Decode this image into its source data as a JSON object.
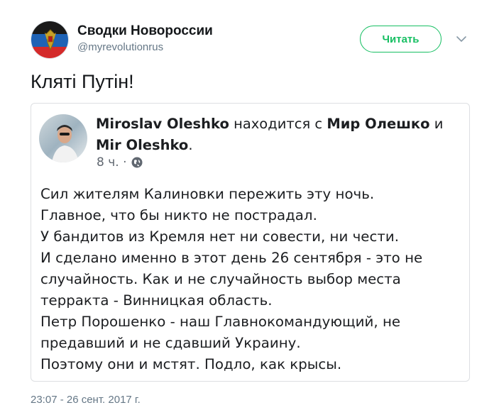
{
  "author": {
    "name": "Сводки Новороссии",
    "handle": "@myrevolutionrus"
  },
  "follow_button_label": "Читать",
  "tweet_text": "Кляті Путін!",
  "embedded_post": {
    "author_name": "Miroslav Oleshko",
    "with_text": " находится с ",
    "tagged_1": "Мир Олешко",
    "and_text": " и ",
    "tagged_2": "Mir Oleshko",
    "period": ".",
    "time": "8 ч. ·",
    "lines": [
      "Сил жителям Калиновки пережить эту ночь.",
      "Главное, что бы никто не пострадал.",
      "У бандитов из Кремля нет ни совести, ни чести.",
      "И сделано именно в этот день 26 сентября - это не",
      "случайность. Как и не случайность выбор места",
      "терракта - Винницкая область.",
      "Петр Порошенко - наш Главнокомандующий, не",
      "предавший и не сдавший Украину.",
      "Поэтому они и мстят. Подло, как крысы."
    ]
  },
  "timestamp": "23:07 - 26 сент. 2017 г.",
  "colors": {
    "follow_accent": "#17bf63",
    "secondary_text": "#657786",
    "embed_border": "#dddfe2"
  },
  "icons": {
    "avatar": "flag-emblem-avatar",
    "caret": "chevron-down-icon",
    "privacy": "globe-icon"
  }
}
